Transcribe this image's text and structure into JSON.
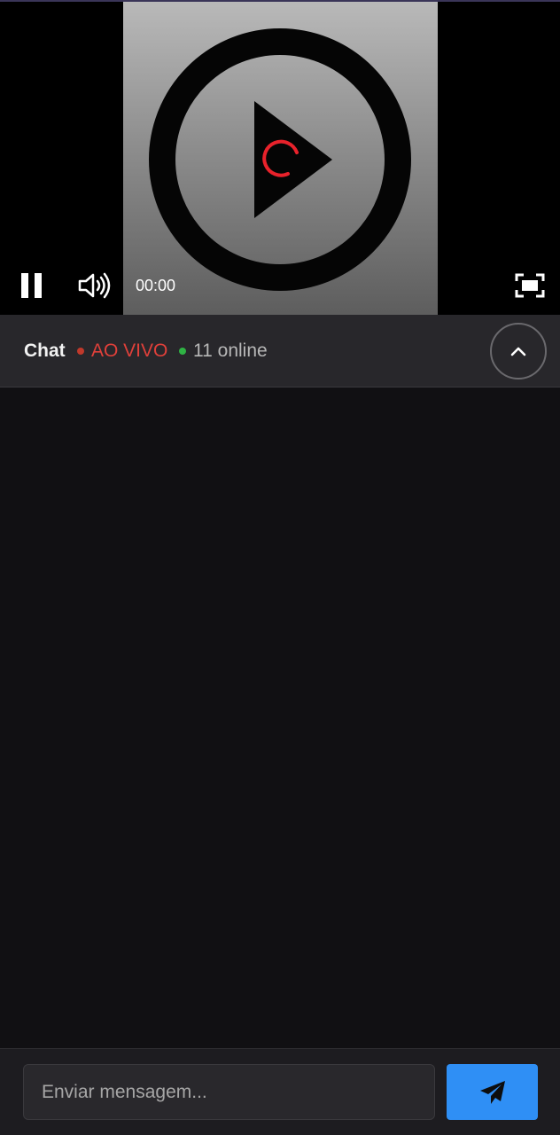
{
  "player": {
    "time": "00:00",
    "icons": {
      "play": "play-icon",
      "spinner": "loading-spinner-icon",
      "pause": "pause-icon",
      "volume": "volume-icon",
      "fullscreen": "fullscreen-icon"
    },
    "colors": {
      "spinner": "#e8222b"
    }
  },
  "chat": {
    "title": "Chat",
    "live_label": "AO VIVO",
    "online_label": "11 online",
    "colors": {
      "live": "#e0403a",
      "online_dot": "#2fb344"
    },
    "collapse_icon": "chevron-up-icon"
  },
  "composer": {
    "placeholder": "Enviar mensagem...",
    "value": "",
    "send_icon": "send-icon",
    "colors": {
      "send_button": "#2f8ff5"
    }
  }
}
